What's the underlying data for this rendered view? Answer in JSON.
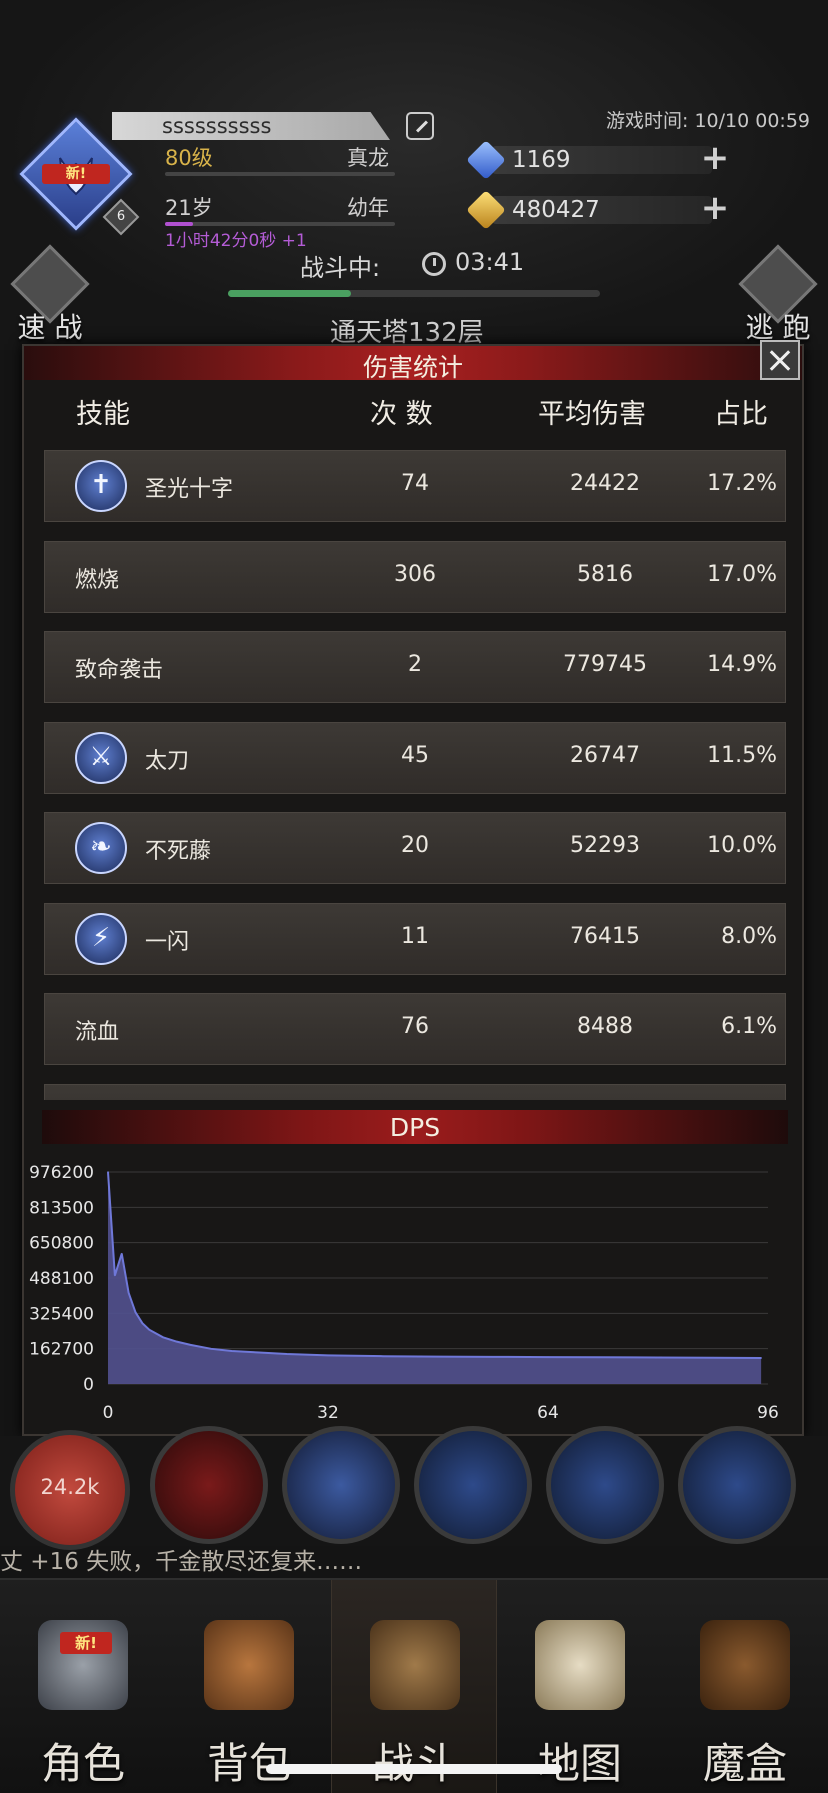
{
  "player": {
    "name": "ssssssssss",
    "avatar_badge": "新!",
    "avatar_level": "6",
    "level": "80级",
    "rank": "真龙",
    "age": "21岁",
    "age_stage": "幼年",
    "timer_note": "1小时42分0秒 +1"
  },
  "game_time": "游戏时间: 10/10 00:59",
  "currency": {
    "gems": "1169",
    "gold": "480427"
  },
  "battle": {
    "status": "战斗中:",
    "timer": "03:41",
    "progress": 0.33,
    "tower": "通天塔132层",
    "quick_battle": "速 战",
    "escape": "逃 跑"
  },
  "damage_panel": {
    "title": "伤害统计",
    "columns": {
      "skill": "技能",
      "count": "次 数",
      "avg": "平均伤害",
      "pct": "占比"
    },
    "rows": [
      {
        "name": "圣光十字",
        "count": "74",
        "avg": "24422",
        "pct": "17.2%",
        "icon": "holy-cross-icon",
        "glyph": "✝"
      },
      {
        "name": "燃烧",
        "count": "306",
        "avg": "5816",
        "pct": "17.0%",
        "icon": "",
        "glyph": ""
      },
      {
        "name": "致命袭击",
        "count": "2",
        "avg": "779745",
        "pct": "14.9%",
        "icon": "",
        "glyph": ""
      },
      {
        "name": "太刀",
        "count": "45",
        "avg": "26747",
        "pct": "11.5%",
        "icon": "katana-icon",
        "glyph": "⚔"
      },
      {
        "name": "不死藤",
        "count": "20",
        "avg": "52293",
        "pct": "10.0%",
        "icon": "vine-icon",
        "glyph": "❧"
      },
      {
        "name": "一闪",
        "count": "11",
        "avg": "76415",
        "pct": "8.0%",
        "icon": "flash-icon",
        "glyph": "⚡"
      },
      {
        "name": "流血",
        "count": "76",
        "avg": "8488",
        "pct": "6.1%",
        "icon": "",
        "glyph": ""
      }
    ]
  },
  "dps": {
    "title": "DPS"
  },
  "chart_data": {
    "type": "area",
    "title": "DPS",
    "xlabel": "",
    "ylabel": "",
    "xlim": [
      0,
      96
    ],
    "ylim": [
      0,
      976200
    ],
    "x_ticks": [
      "0",
      "32",
      "64",
      "96"
    ],
    "y_ticks": [
      "976200",
      "813500",
      "650800",
      "488100",
      "325400",
      "162700",
      "0"
    ],
    "grid": true,
    "fill_color": "#52518f",
    "line_color": "#6f78d8",
    "series": [
      {
        "x": [
          0,
          1,
          2,
          3,
          4,
          5,
          6,
          8,
          10,
          12,
          15,
          18,
          22,
          26,
          32,
          40,
          48,
          56,
          64,
          72,
          80,
          88,
          95
        ],
        "y": [
          976200,
          500000,
          600000,
          420000,
          330000,
          280000,
          250000,
          215000,
          195000,
          180000,
          162000,
          152000,
          145000,
          138000,
          132000,
          128000,
          126000,
          125000,
          124000,
          123000,
          122000,
          121000,
          120000
        ]
      }
    ]
  },
  "skill_bar": {
    "hp_value": "24.2k"
  },
  "battle_log": "丈 +16 失败，千金散尽还复来……",
  "nav": [
    {
      "label": "角色",
      "badge": "新!"
    },
    {
      "label": "背包"
    },
    {
      "label": "战斗"
    },
    {
      "label": "地图"
    },
    {
      "label": "魔盒"
    }
  ]
}
